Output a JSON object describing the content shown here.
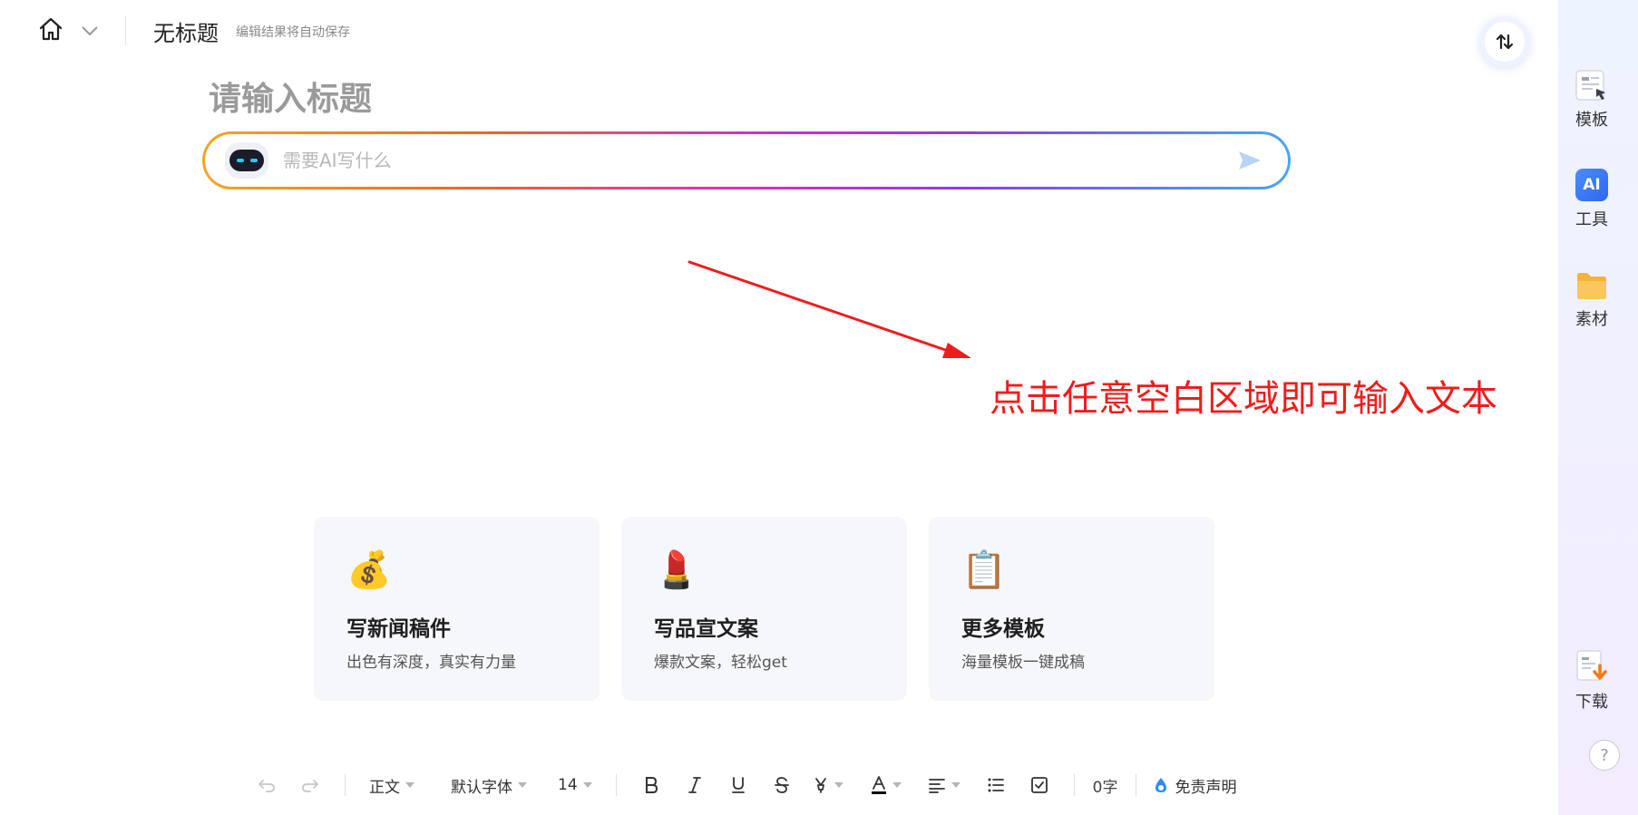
{
  "header": {
    "doc_title": "无标题",
    "autosave_note": "编辑结果将自动保存",
    "home_icon": "home-icon",
    "sort_icon": "sort-toggle-icon"
  },
  "editor": {
    "title_placeholder": "请输入标题",
    "ai_input_placeholder": "需要AI写什么"
  },
  "annotation": {
    "hint": "点击任意空白区域即可输入文本",
    "color": "#f01c1c"
  },
  "templates": [
    {
      "emoji": "💰",
      "title": "写新闻稿件",
      "subtitle": "出色有深度，真实有力量"
    },
    {
      "emoji": "💄",
      "title": "写品宣文案",
      "subtitle": "爆款文案，轻松get"
    },
    {
      "emoji": "📋",
      "title": "更多模板",
      "subtitle": "海量模板一键成稿"
    }
  ],
  "sidebar": {
    "items": [
      {
        "label": "模板",
        "icon": "template-icon"
      },
      {
        "label": "工具",
        "icon": "ai-tool-icon",
        "badge": "AI"
      },
      {
        "label": "素材",
        "icon": "folder-icon"
      }
    ],
    "download_label": "下载",
    "help_label": "?"
  },
  "toolbar": {
    "paragraph_style": "正文",
    "font_family": "默认字体",
    "font_size": "14",
    "word_count": "0字",
    "disclaimer": "免责声明"
  },
  "colors": {
    "gradient_start": "#f5a524",
    "gradient_end": "#4aa6f5",
    "sidebar_bg": "#edf4ff"
  }
}
